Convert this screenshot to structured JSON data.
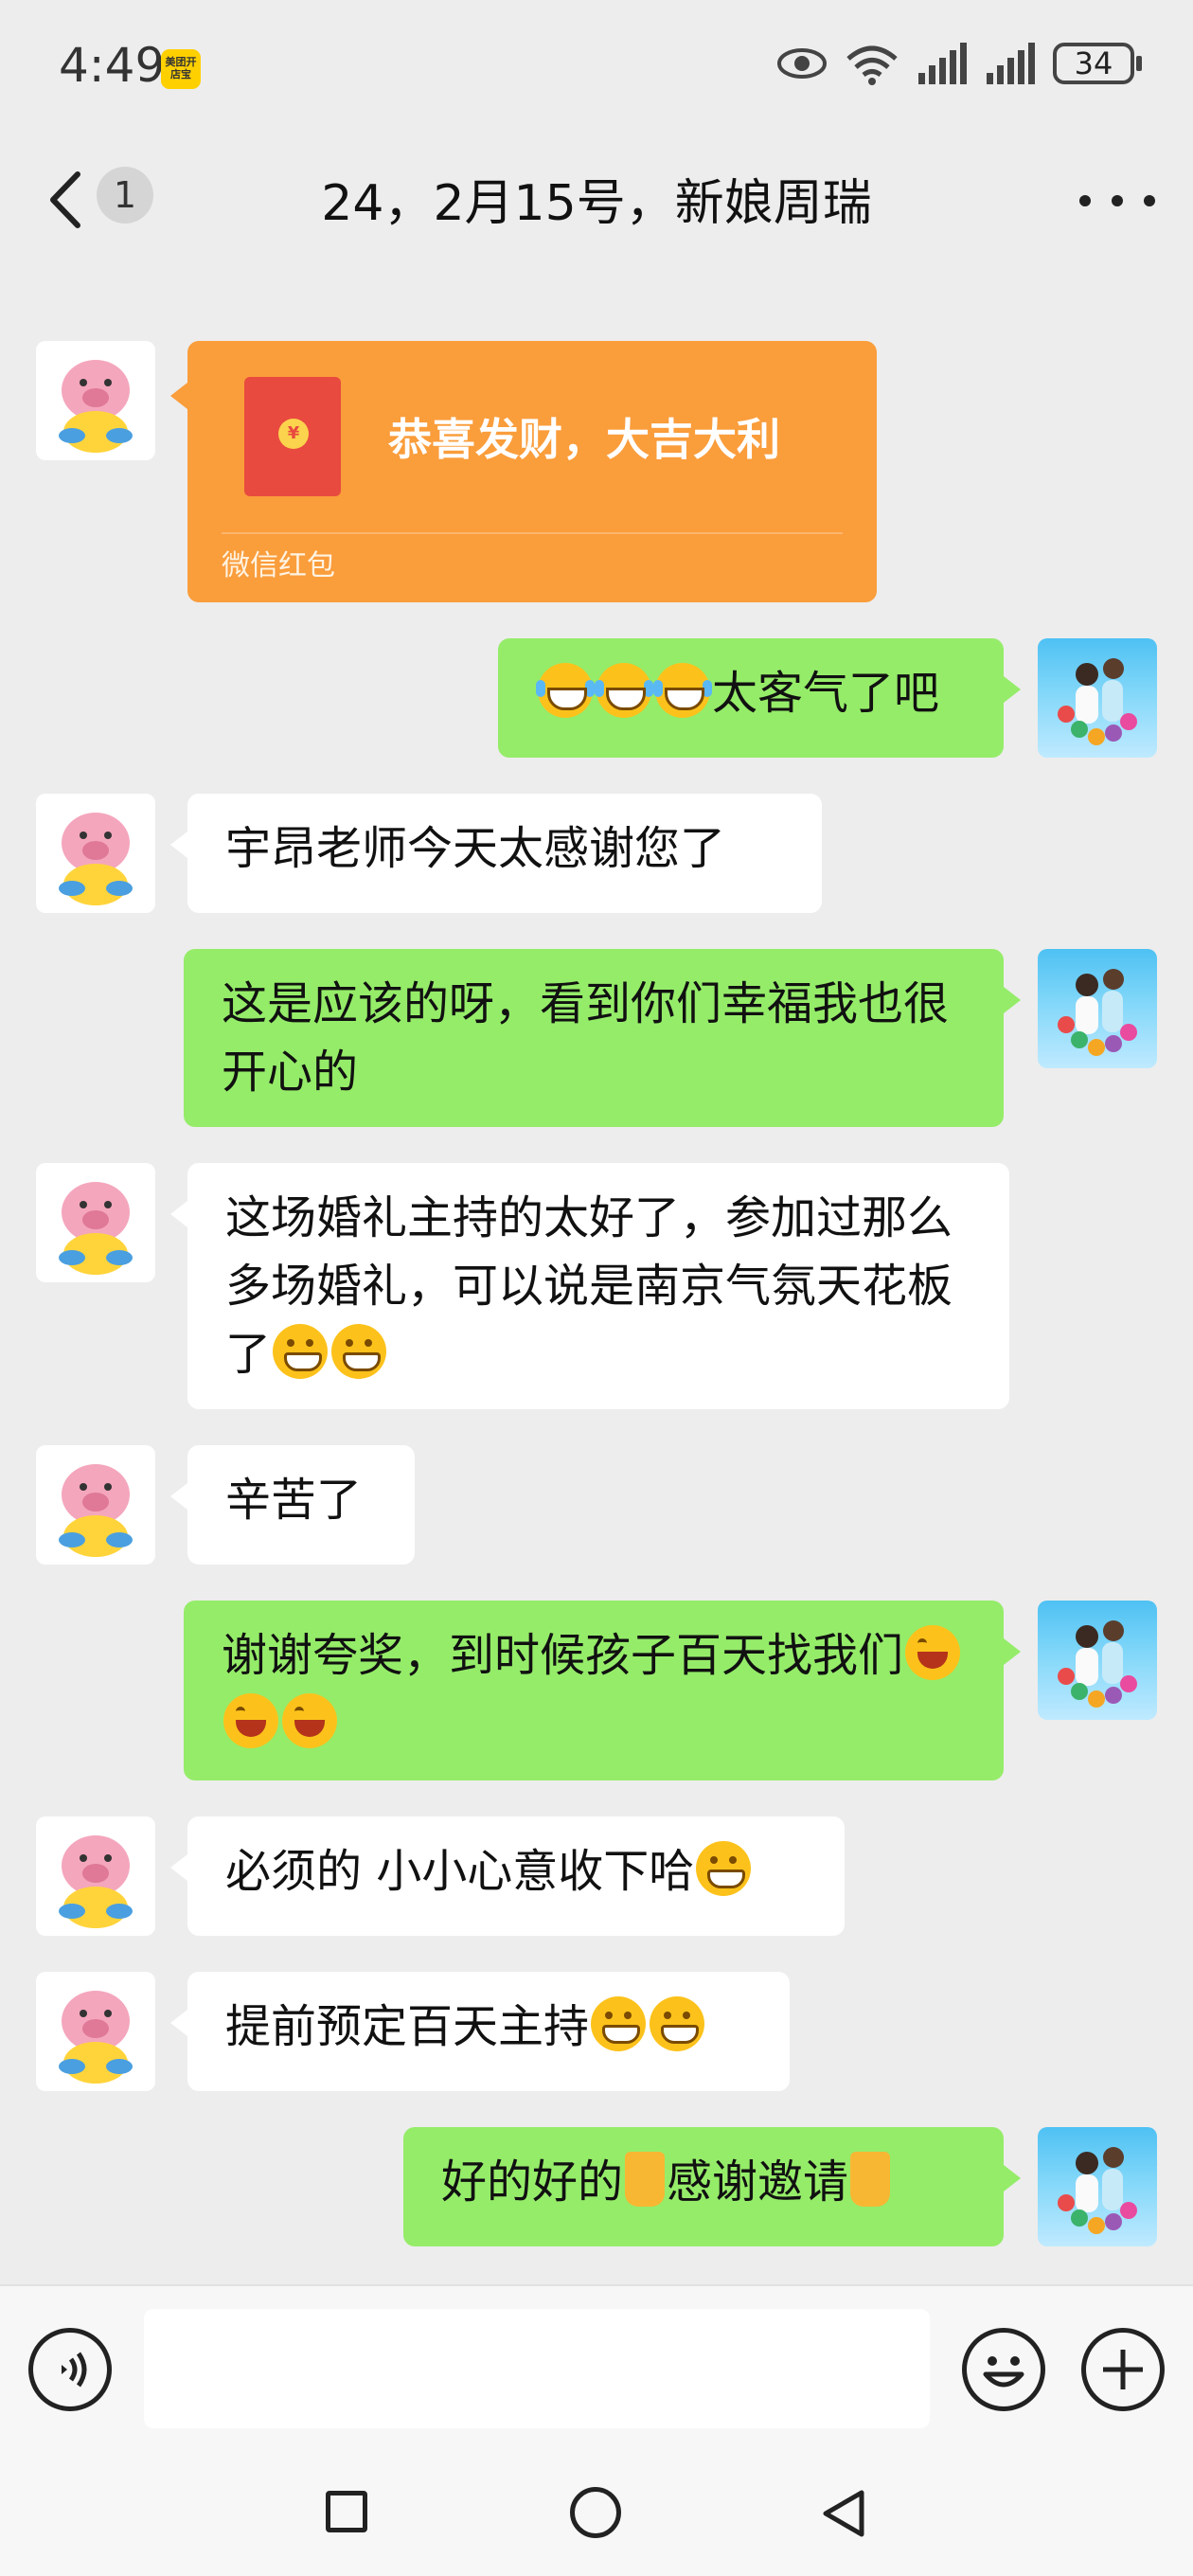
{
  "status_bar": {
    "time": "4:49",
    "app_badge": "美团开店宝",
    "battery": "34"
  },
  "header": {
    "back_label": "back",
    "unread_count": "1",
    "title": "24，2月15号，新娘周瑞",
    "more_icon": "more-dots-icon"
  },
  "messages": [
    {
      "side": "left",
      "type": "red_packet",
      "title": "恭喜发财，大吉大利",
      "footer": "微信红包"
    },
    {
      "side": "right",
      "emoji": [
        "cry",
        "cry",
        "cry"
      ],
      "text": "太客气了吧"
    },
    {
      "side": "left",
      "text": "宇昂老师今天太感谢您了"
    },
    {
      "side": "right",
      "text": "这是应该的呀，看到你们幸福我也很开心的"
    },
    {
      "side": "left",
      "text": "这场婚礼主持的太好了，参加过那么多场婚礼，可以说是南京气氛天花板了",
      "emoji_after": [
        "grin",
        "grin"
      ]
    },
    {
      "side": "left",
      "text": "辛苦了"
    },
    {
      "side": "right",
      "text": "谢谢夸奖，到时候孩子百天找我们",
      "emoji_after": [
        "laugh",
        "laugh",
        "laugh"
      ]
    },
    {
      "side": "left",
      "text": "必须的 小小心意收下哈",
      "emoji_after": [
        "grin"
      ]
    },
    {
      "side": "left",
      "text": "提前预定百天主持",
      "emoji_after": [
        "grin",
        "grin"
      ]
    },
    {
      "side": "right",
      "text_parts": [
        "好的好的",
        "感谢邀请"
      ],
      "emoji_between": "pray",
      "emoji_after": [
        "pray"
      ]
    }
  ],
  "input_bar": {
    "voice_icon": "voice-icon",
    "placeholder": "",
    "emoji_icon": "emoji-icon",
    "plus_icon": "plus-icon"
  },
  "nav_bar": {
    "recent_icon": "square-icon",
    "home_icon": "circle-icon",
    "back_icon": "triangle-back-icon"
  },
  "colors": {
    "background": "#ededed",
    "bubble_self": "#95ec69",
    "bubble_other": "#ffffff",
    "red_packet": "#fa9d3b"
  }
}
